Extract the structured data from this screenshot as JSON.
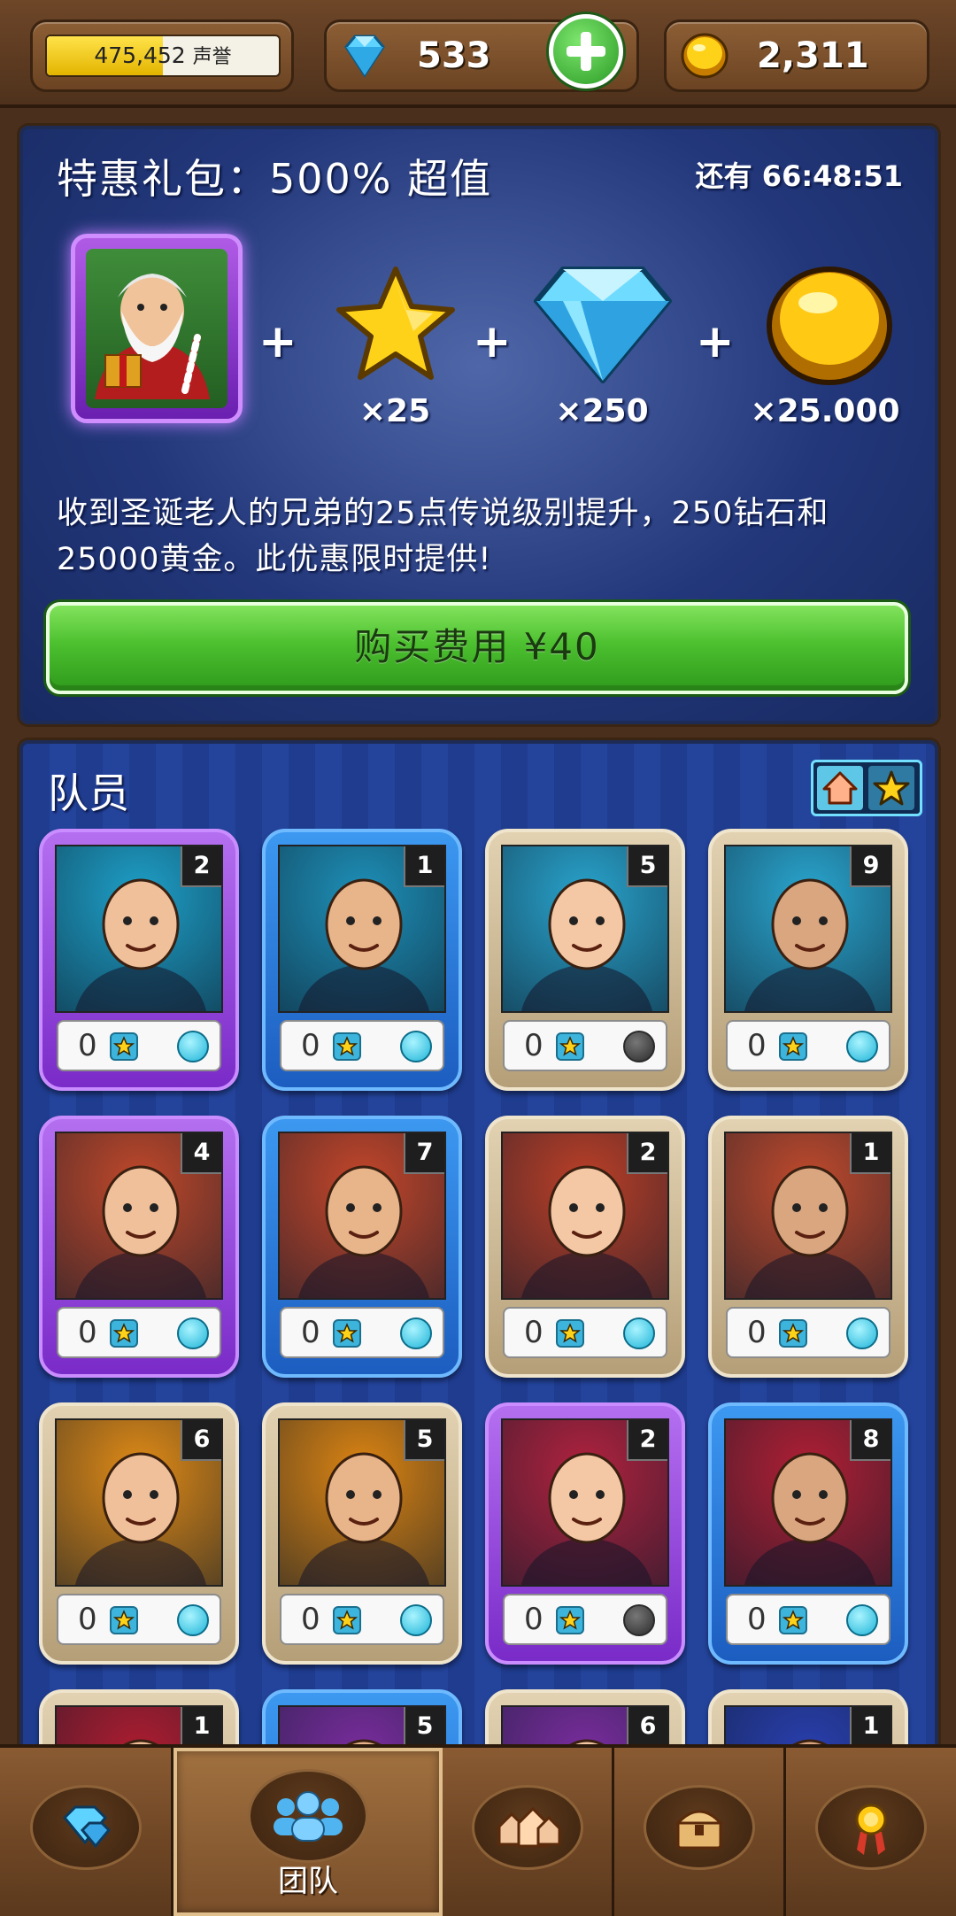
{
  "topbar": {
    "reputation_value": "475,452",
    "reputation_unit": "声誉",
    "reputation_progress": 0.5,
    "gems": "533",
    "gold": "2,311"
  },
  "offer": {
    "title": "特惠礼包：500% 超值",
    "timer": "还有 66:48:51",
    "items": [
      {
        "icon": "star-icon",
        "qty": "×25"
      },
      {
        "icon": "diamond-icon",
        "qty": "×250"
      },
      {
        "icon": "gold-coin-icon",
        "qty": "×25.000"
      }
    ],
    "description": "收到圣诞老人的兄弟的25点传说级别提升，250钻石和25000黄金。此优惠限时提供!",
    "buy_label": "购买费用 ¥40"
  },
  "team": {
    "title": "队员",
    "members": [
      {
        "level": "2",
        "stars": "0",
        "frame": "purple",
        "bg": "#1ea0c8",
        "active": true
      },
      {
        "level": "1",
        "stars": "0",
        "frame": "blue",
        "bg": "#1e90b8",
        "active": true
      },
      {
        "level": "5",
        "stars": "0",
        "frame": "tan",
        "bg": "#29a3cc",
        "active": false
      },
      {
        "level": "9",
        "stars": "0",
        "frame": "tan",
        "bg": "#2aa6cf",
        "active": true
      },
      {
        "level": "4",
        "stars": "0",
        "frame": "purple",
        "bg": "#c0482a",
        "active": true
      },
      {
        "level": "7",
        "stars": "0",
        "frame": "blue",
        "bg": "#c4462a",
        "active": true
      },
      {
        "level": "2",
        "stars": "0",
        "frame": "tan",
        "bg": "#bb3f28",
        "active": true
      },
      {
        "level": "1",
        "stars": "0",
        "frame": "tan",
        "bg": "#c04a2c",
        "active": true
      },
      {
        "level": "6",
        "stars": "0",
        "frame": "tan",
        "bg": "#e08a16",
        "active": true
      },
      {
        "level": "5",
        "stars": "0",
        "frame": "tan",
        "bg": "#dc8412",
        "active": true
      },
      {
        "level": "2",
        "stars": "0",
        "frame": "purple",
        "bg": "#b0223e",
        "active": false
      },
      {
        "level": "8",
        "stars": "0",
        "frame": "blue",
        "bg": "#b01f34",
        "active": true
      },
      {
        "level": "1",
        "stars": "",
        "frame": "tan",
        "bg": "#b01c30",
        "active": true
      },
      {
        "level": "5",
        "stars": "",
        "frame": "blue",
        "bg": "#7a2d9e",
        "active": true
      },
      {
        "level": "6",
        "stars": "",
        "frame": "tan",
        "bg": "#7a2d9e",
        "active": true
      },
      {
        "level": "1",
        "stars": "",
        "frame": "tan",
        "bg": "#2a3fb0",
        "active": true
      }
    ]
  },
  "nav": {
    "tabs": [
      {
        "icon": "gems-icon",
        "label": ""
      },
      {
        "icon": "team-icon",
        "label": "团队"
      },
      {
        "icon": "village-icon",
        "label": ""
      },
      {
        "icon": "chest-icon",
        "label": ""
      },
      {
        "icon": "medal-icon",
        "label": ""
      }
    ]
  },
  "colors": {
    "offer_bg": "#22377a",
    "buy_green": "#4cc02f",
    "purple_frame": "#9a4ae0",
    "blue_frame": "#2c7ad8",
    "tan_frame": "#d2c09c"
  }
}
